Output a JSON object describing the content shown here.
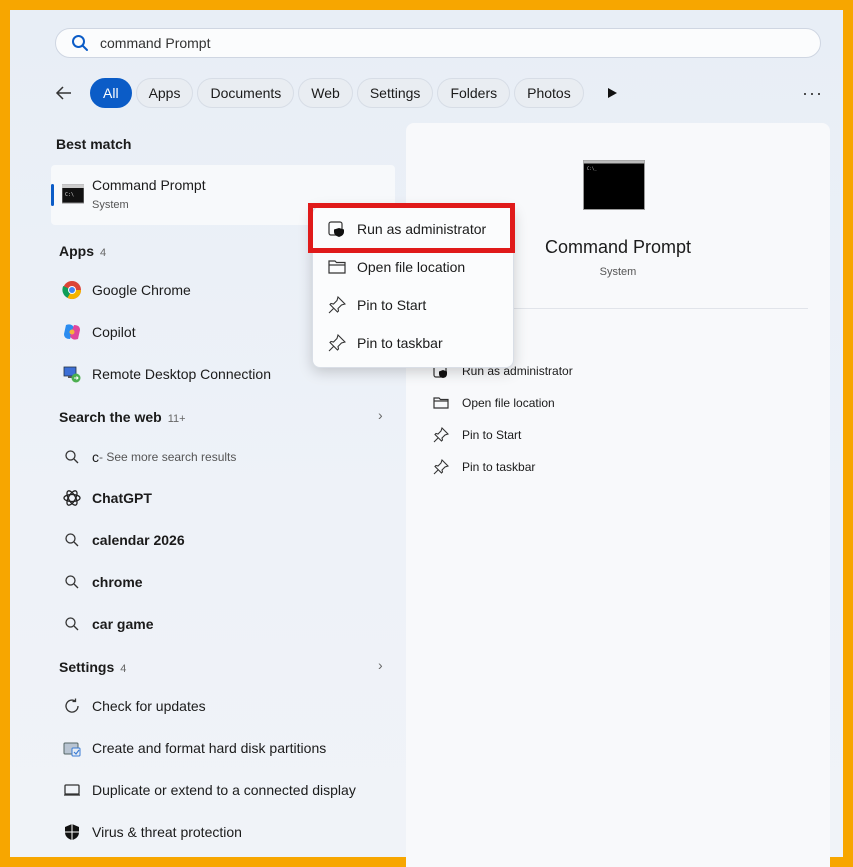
{
  "search": {
    "query": "command Prompt"
  },
  "filters": {
    "tabs": [
      {
        "label": "All",
        "active": true
      },
      {
        "label": "Apps"
      },
      {
        "label": "Documents"
      },
      {
        "label": "Web"
      },
      {
        "label": "Settings"
      },
      {
        "label": "Folders"
      },
      {
        "label": "Photos"
      }
    ],
    "more_glyph": "···"
  },
  "best_match": {
    "heading": "Best match",
    "title": "Command Prompt",
    "subtitle": "System"
  },
  "apps": {
    "heading": "Apps",
    "count": "4",
    "items": [
      {
        "label": "Google Chrome",
        "icon": "chrome-icon"
      },
      {
        "label": "Copilot",
        "icon": "copilot-icon"
      },
      {
        "label": "Remote Desktop Connection",
        "icon": "remote-desktop-icon"
      }
    ]
  },
  "web": {
    "heading": "Search the web",
    "count": "11+",
    "items": [
      {
        "label": "c",
        "suffix": " - See more search results",
        "icon": "search-icon"
      },
      {
        "label": "ChatGPT",
        "icon": "chatgpt-icon"
      },
      {
        "label": "calendar 2026",
        "icon": "search-icon"
      },
      {
        "label": "chrome",
        "icon": "search-icon"
      },
      {
        "label": "car game",
        "icon": "search-icon"
      }
    ]
  },
  "settings": {
    "heading": "Settings",
    "count": "4",
    "items": [
      {
        "label": "Check for updates",
        "icon": "refresh-icon"
      },
      {
        "label": "Create and format hard disk partitions",
        "icon": "disk-management-icon"
      },
      {
        "label": "Duplicate or extend to a connected display",
        "icon": "display-icon"
      },
      {
        "label": "Virus & threat protection",
        "icon": "shield-icon"
      }
    ]
  },
  "panel": {
    "title": "Command Prompt",
    "subtitle": "System",
    "actions": [
      {
        "label": "Run as administrator",
        "icon": "admin-shield-icon"
      },
      {
        "label": "Open file location",
        "icon": "folder-icon"
      },
      {
        "label": "Pin to Start",
        "icon": "pin-icon"
      },
      {
        "label": "Pin to taskbar",
        "icon": "pin-icon"
      }
    ]
  },
  "context_menu": {
    "items": [
      {
        "label": "Run as administrator",
        "icon": "admin-shield-icon"
      },
      {
        "label": "Open file location",
        "icon": "folder-icon"
      },
      {
        "label": "Pin to Start",
        "icon": "pin-icon"
      },
      {
        "label": "Pin to taskbar",
        "icon": "pin-icon"
      }
    ]
  },
  "colors": {
    "frame": "#f7a600",
    "accent": "#0b5cc7",
    "highlight": "#e01a1a"
  }
}
